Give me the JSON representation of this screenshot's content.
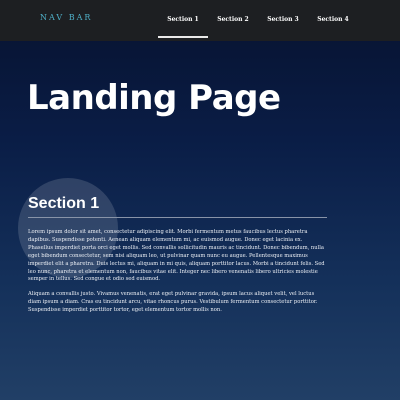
{
  "navbar": {
    "brand": "NAV BAR",
    "items": [
      {
        "label": "Section 1",
        "active": true
      },
      {
        "label": "Section 2",
        "active": false
      },
      {
        "label": "Section 3",
        "active": false
      },
      {
        "label": "Section 4",
        "active": false
      }
    ]
  },
  "main": {
    "title": "Landing Page",
    "section": {
      "heading": "Section 1",
      "paragraphs": [
        "Lorem ipsum dolor sit amet, consectetur adipiscing elit. Morbi fermentum metus faucibus lectus pharetra dapibus. Suspendisse potenti. Aenean aliquam elementum mi, ac euismod augue. Donec eget lacinia ex. Phasellus imperdiet porta orci eget mollis. Sed convallis sollicitudin mauris ac tincidunt. Donec bibendum, nulla eget bibendum consectetur, sem nisi aliquam leo, ut pulvinar quam nunc eu augue. Pellentesque maximus imperdiet elit a pharetra. Duis lectus mi, aliquam in mi quis, aliquam porttitor lacus. Morbi a tincidunt felis. Sed leo nunc, pharetra et elementum non, faucibus vitae elit. Integer nec libero venenatis libero ultricies molestie semper in tellus. Sed congue et odio sed euismod.",
        "Aliquam a convallis justo. Vivamus venenatis, erat eget pulvinar gravida, ipsum lacus aliquet velit, vel luctus diam ipsum a diam. Cras eu tincidunt arcu, vitae rhoncus purus. Vestibulum fermentum consectetur porttitor. Suspendisse imperdiet porttitor tortor, eget elementum tortor mollis non."
      ]
    }
  },
  "colors": {
    "navbar_bg": "#1d1f22",
    "brand": "#4fb0c8",
    "page_bg_top": "#07122f",
    "page_bg_bottom": "#213f66"
  }
}
